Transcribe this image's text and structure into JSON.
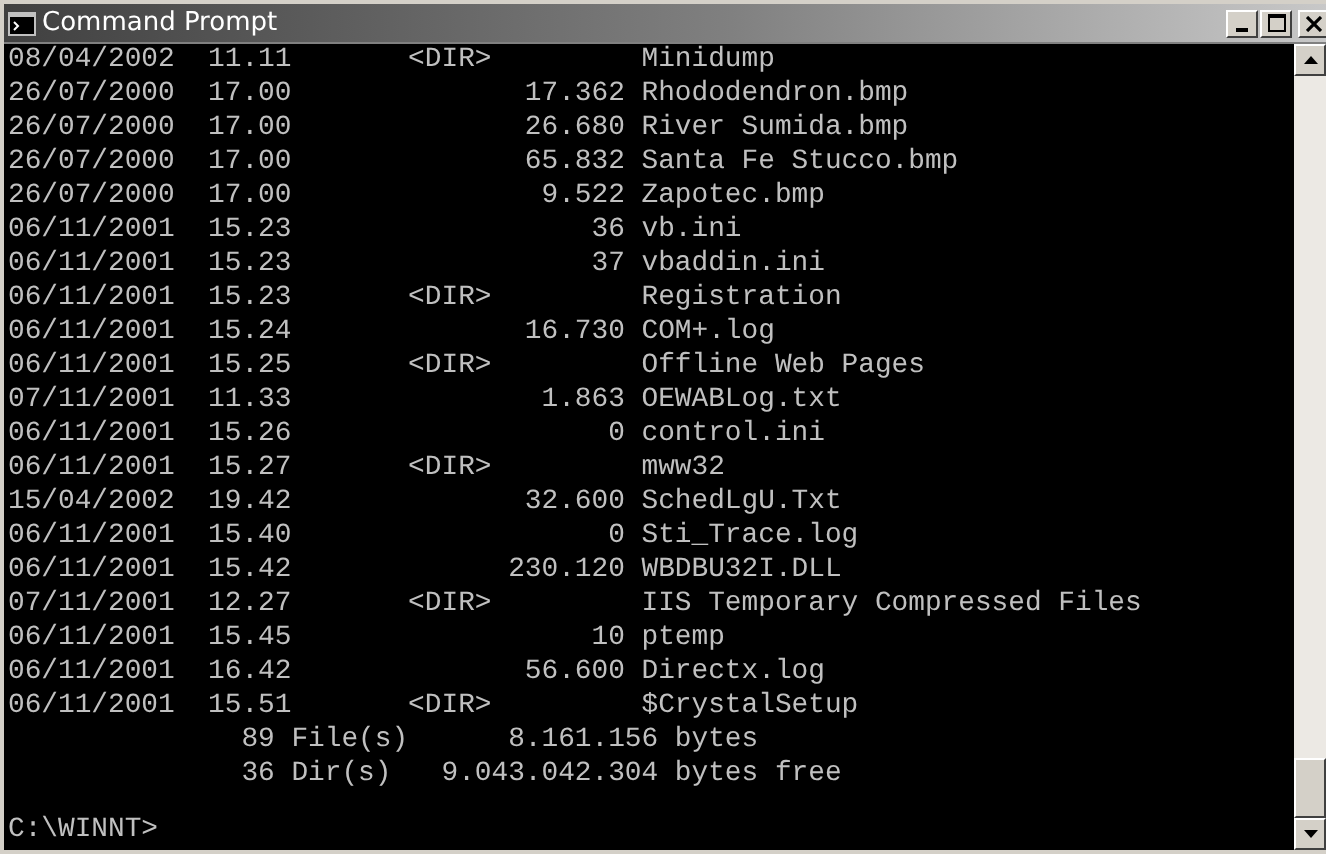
{
  "window": {
    "title": "Command Prompt"
  },
  "console": {
    "lines": [
      "08/04/2002  11.11       <DIR>         Minidump",
      "26/07/2000  17.00              17.362 Rhododendron.bmp",
      "26/07/2000  17.00              26.680 River Sumida.bmp",
      "26/07/2000  17.00              65.832 Santa Fe Stucco.bmp",
      "26/07/2000  17.00               9.522 Zapotec.bmp",
      "06/11/2001  15.23                  36 vb.ini",
      "06/11/2001  15.23                  37 vbaddin.ini",
      "06/11/2001  15.23       <DIR>         Registration",
      "06/11/2001  15.24              16.730 COM+.log",
      "06/11/2001  15.25       <DIR>         Offline Web Pages",
      "07/11/2001  11.33               1.863 OEWABLog.txt",
      "06/11/2001  15.26                   0 control.ini",
      "06/11/2001  15.27       <DIR>         mww32",
      "15/04/2002  19.42              32.600 SchedLgU.Txt",
      "06/11/2001  15.40                   0 Sti_Trace.log",
      "06/11/2001  15.42             230.120 WBDBU32I.DLL",
      "07/11/2001  12.27       <DIR>         IIS Temporary Compressed Files",
      "06/11/2001  15.45                  10 ptemp",
      "06/11/2001  16.42              56.600 Directx.log",
      "06/11/2001  15.51       <DIR>         $CrystalSetup",
      "              89 File(s)      8.161.156 bytes",
      "              36 Dir(s)   9.043.042.304 bytes free"
    ],
    "prompt": "C:\\WINNT>"
  }
}
